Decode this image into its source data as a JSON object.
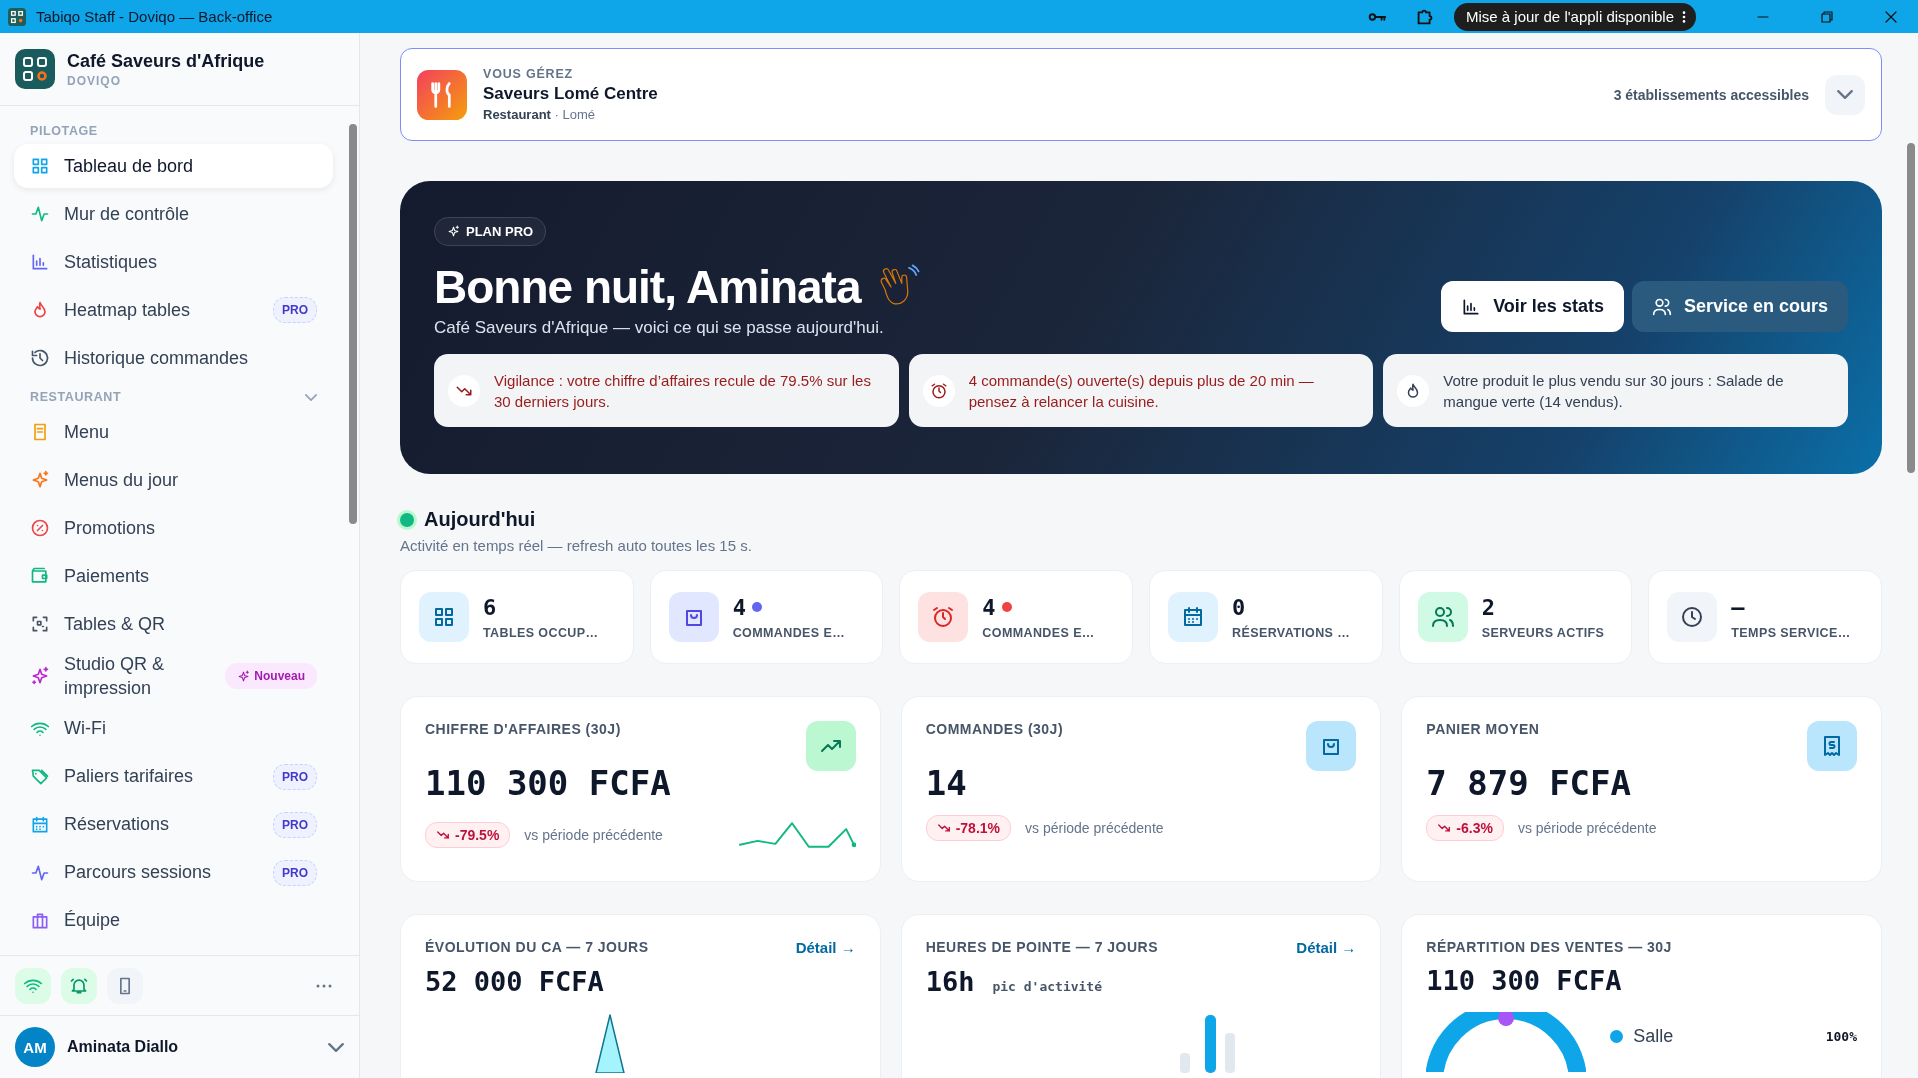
{
  "window": {
    "title": "Tabiqo Staff - Doviqo — Back-office",
    "update_button": "Mise à jour de l'appli disponible"
  },
  "brand": {
    "name": "Café Saveurs d'Afrique",
    "subtitle": "DOVIQO"
  },
  "sidebar": {
    "sections": [
      {
        "title": "PILOTAGE",
        "collapsible": false,
        "items": [
          {
            "label": "Tableau de bord",
            "kind": "grid",
            "selected": true
          },
          {
            "label": "Mur de contrôle",
            "kind": "pulse",
            "selected": false
          },
          {
            "label": "Statistiques",
            "kind": "bars",
            "selected": false
          },
          {
            "label": "Heatmap tables",
            "kind": "flame",
            "selected": false,
            "badge": {
              "text": "PRO",
              "kind": "pro"
            }
          },
          {
            "label": "Historique commandes",
            "kind": "history",
            "selected": false
          }
        ]
      },
      {
        "title": "RESTAURANT",
        "collapsible": true,
        "items": [
          {
            "label": "Menu",
            "kind": "book",
            "selected": false
          },
          {
            "label": "Menus du jour",
            "kind": "sparkle",
            "selected": false
          },
          {
            "label": "Promotions",
            "kind": "percent",
            "selected": false
          },
          {
            "label": "Paiements",
            "kind": "wallet",
            "selected": false
          },
          {
            "label": "Tables & QR",
            "kind": "qr",
            "selected": false
          },
          {
            "label": "Studio QR & impression",
            "kind": "stars",
            "selected": false,
            "badge": {
              "text": "Nouveau",
              "kind": "new"
            }
          },
          {
            "label": "Wi-Fi",
            "kind": "wifi",
            "selected": false
          },
          {
            "label": "Paliers tarifaires",
            "kind": "tag",
            "selected": false,
            "badge": {
              "text": "PRO",
              "kind": "pro"
            }
          },
          {
            "label": "Réservations",
            "kind": "calendar",
            "selected": false,
            "badge": {
              "text": "PRO",
              "kind": "pro"
            }
          },
          {
            "label": "Parcours sessions",
            "kind": "pulse2",
            "selected": false,
            "badge": {
              "text": "PRO",
              "kind": "pro"
            }
          },
          {
            "label": "Équipe",
            "kind": "team",
            "selected": false
          }
        ]
      }
    ],
    "footer_buttons": [
      {
        "kind": "wifi"
      },
      {
        "kind": "bell"
      },
      {
        "kind": "phone"
      }
    ],
    "user": {
      "initials": "AM",
      "name": "Aminata Diallo"
    }
  },
  "establishment": {
    "label": "VOUS GÉREZ",
    "name": "Saveurs Lomé Centre",
    "meta": "**Restaurant** · Lomé",
    "accessible": "3 établissements accessibles"
  },
  "hero": {
    "plan": "PLAN PRO",
    "greeting": "Bonne nuit, Aminata",
    "subtitle": "Café Saveurs d'Afrique — voici ce qui se passe aujourd'hui.",
    "buttons": [
      {
        "label": "Voir les stats",
        "kind": "primary"
      },
      {
        "label": "Service en cours",
        "kind": "secondary"
      }
    ],
    "alerts": [
      {
        "kind": "trend",
        "warning": true,
        "text": "Vigilance : votre chiffre d’affaires recule de 79.5% sur les 30 derniers jours."
      },
      {
        "kind": "alarm",
        "warning": true,
        "text": "4 commande(s) ouverte(s) depuis plus de 20 min — pensez à relancer la cuisine."
      },
      {
        "kind": "flame",
        "warning": false,
        "text": "Votre produit le plus vendu sur 30 jours : Salade de mangue verte (14 vendus)."
      }
    ]
  },
  "today": {
    "title": "Aujourd'hui",
    "live": true,
    "subtitle": "Activité en temps réel — refresh auto toutes les 15 s.",
    "stats": [
      {
        "kind": "grid",
        "value": "6",
        "label": "TABLES OCCUP…"
      },
      {
        "kind": "bag",
        "value": "4",
        "label": "COMMANDES E…",
        "color": "#6366f1"
      },
      {
        "kind": "alarm",
        "value": "4",
        "label": "COMMANDES E…",
        "color": "#ef4444"
      },
      {
        "kind": "calendar",
        "value": "0",
        "label": "RÉSERVATIONS …"
      },
      {
        "kind": "users",
        "value": "2",
        "label": "SERVEURS ACTIFS"
      },
      {
        "kind": "clock",
        "value": "–",
        "label": "TEMPS SERVICE…"
      }
    ]
  },
  "kpis": [
    {
      "kind": "trendup",
      "title": "CHIFFRE D'AFFAIRES (30J)",
      "value": "110 300 FCFA",
      "delta": "-79.5%",
      "note": "vs période précédente",
      "sparkline": true
    },
    {
      "kind": "bag",
      "title": "COMMANDES (30J)",
      "value": "14",
      "delta": "-78.1%",
      "note": "vs période précédente",
      "sparkline": false
    },
    {
      "kind": "receipt",
      "title": "PANIER MOYEN",
      "value": "7 879 FCFA",
      "delta": "-6.3%",
      "note": "vs période précédente",
      "sparkline": false
    }
  ],
  "panels": [
    {
      "kind": "area",
      "title": "ÉVOLUTION DU CA — 7 JOURS",
      "link": "Détail →",
      "value": "52 000 FCFA"
    },
    {
      "kind": "bars",
      "title": "HEURES DE POINTE — 7 JOURS",
      "link": "Détail →",
      "value": "16h",
      "note": "pic d'activité"
    },
    {
      "kind": "donut",
      "title": "RÉPARTITION DES VENTES — 30J",
      "value": "110 300 FCFA",
      "legend": [
        {
          "label": "Salle",
          "value": "100%",
          "color": "#0ea5e9"
        }
      ]
    }
  ]
}
